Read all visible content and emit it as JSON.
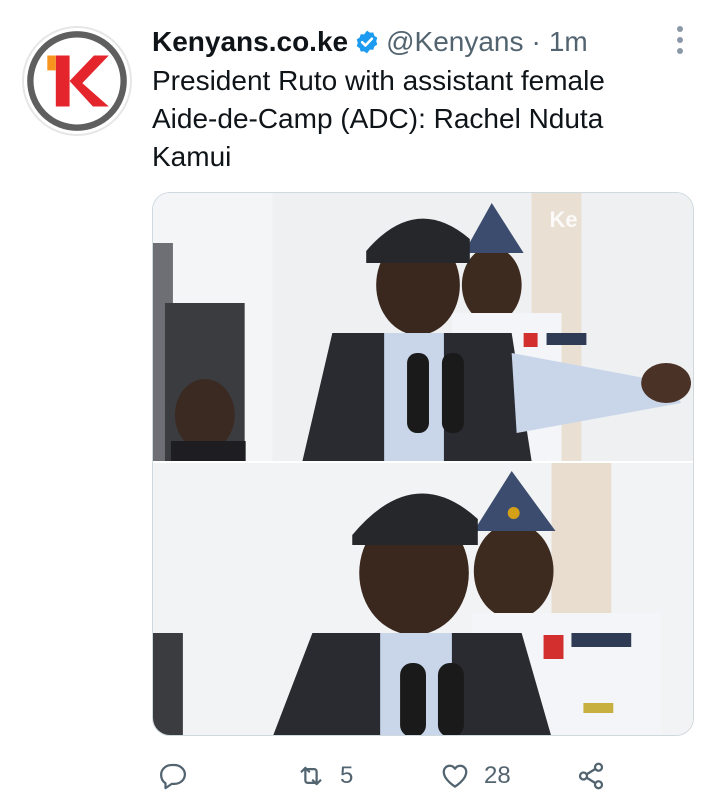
{
  "tweet": {
    "display_name": "Kenyans.co.ke",
    "handle": "@Kenyans",
    "separator": "·",
    "time": "1m",
    "text": "President Ruto with assistant female\nAide-de-Camp (ADC): Rachel Nduta\nKamui",
    "avatar_icon": "kenyans-logo-icon",
    "verified_icon": "verified-badge-icon",
    "media": {
      "image_count": 2,
      "watermark_text": "Ke"
    },
    "actions": {
      "reply_icon": "reply-icon",
      "retweet_icon": "retweet-icon",
      "retweet_count": "5",
      "like_icon": "heart-icon",
      "like_count": "28",
      "share_icon": "share-icon"
    }
  },
  "colors": {
    "verified_blue": "#1d9bf0",
    "muted_text": "#536471",
    "logo_red": "#e4252c",
    "logo_orange": "#f7941d"
  }
}
